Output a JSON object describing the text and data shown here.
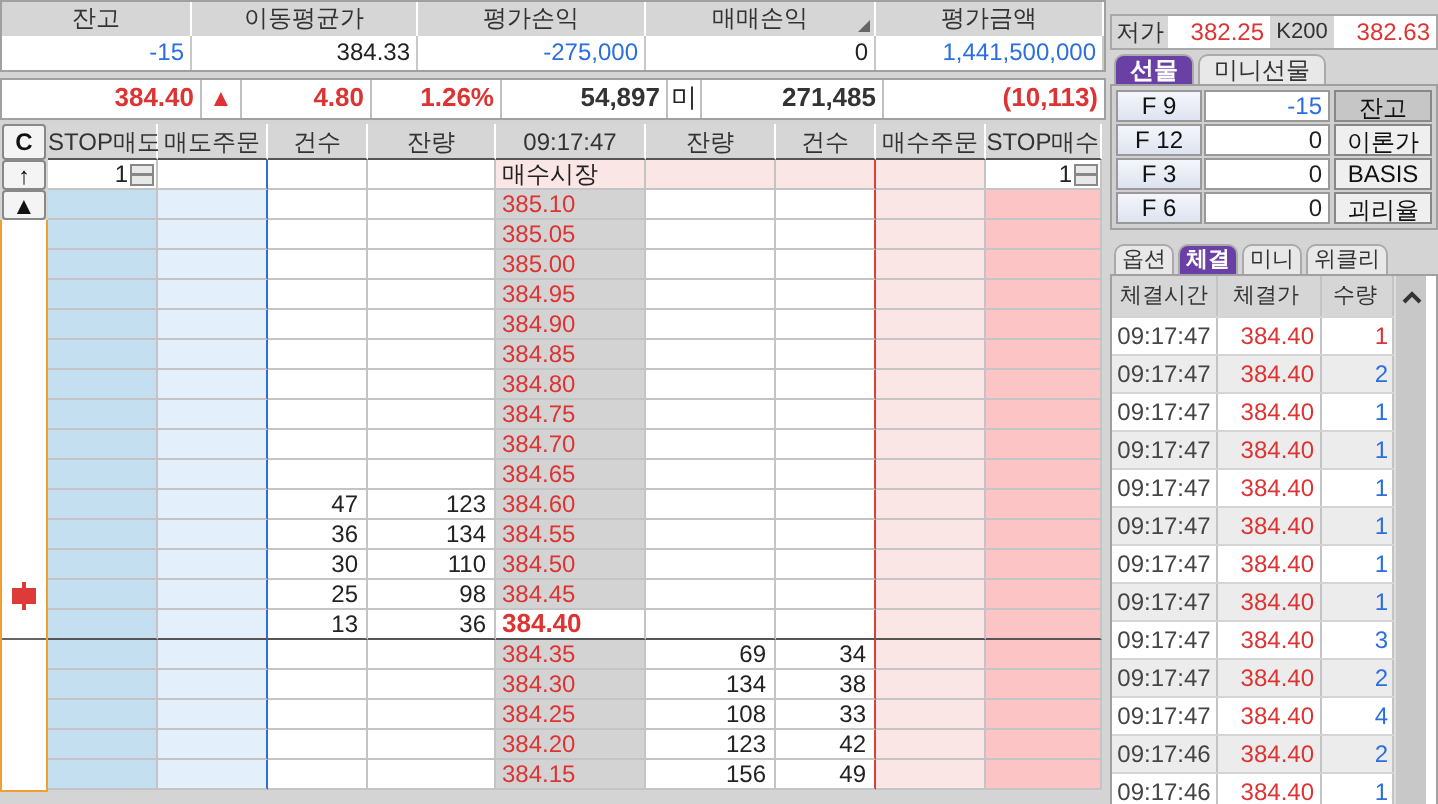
{
  "summary": {
    "columns": [
      {
        "label": "잔고",
        "value": "-15",
        "color": "#2a6ee0"
      },
      {
        "label": "이동평균가",
        "value": "384.33",
        "color": "#222222"
      },
      {
        "label": "평가손익",
        "value": "-275,000",
        "color": "#2a6ee0"
      },
      {
        "label": "매매손익",
        "value": "0",
        "color": "#222222",
        "sort_mark": true
      },
      {
        "label": "평가금액",
        "value": "1,441,500,000",
        "color": "#2a6ee0"
      }
    ]
  },
  "quote": {
    "cells": [
      {
        "text": "384.40",
        "color": "#dd3333"
      },
      {
        "text": "▲",
        "color": "#dd3333"
      },
      {
        "text": "4.80",
        "color": "#dd3333"
      },
      {
        "text": "1.26%",
        "color": "#dd3333"
      },
      {
        "text": "54,897",
        "color": "#333333"
      },
      {
        "text": "미",
        "color": "#222222"
      },
      {
        "text": "271,485",
        "color": "#333333"
      },
      {
        "text": "(10,113)",
        "color": "#dd3333"
      }
    ]
  },
  "side_buttons": [
    "C",
    "↑",
    "▲"
  ],
  "order_book": {
    "headers": [
      "STOP매도",
      "매도주문",
      "건수",
      "잔량",
      "09:17:47",
      "잔량",
      "건수",
      "매수주문",
      "STOP매수"
    ],
    "market_row": {
      "stop_sell": "1",
      "label": "매수시장",
      "stop_buy": "1"
    },
    "rows": [
      {
        "price": "385.10",
        "current": false
      },
      {
        "price": "385.05",
        "current": false
      },
      {
        "price": "385.00",
        "current": false
      },
      {
        "price": "384.95",
        "current": false
      },
      {
        "price": "384.90",
        "current": false
      },
      {
        "price": "384.85",
        "current": false
      },
      {
        "price": "384.80",
        "current": false
      },
      {
        "price": "384.75",
        "current": false
      },
      {
        "price": "384.70",
        "current": false
      },
      {
        "price": "384.65",
        "current": false
      },
      {
        "price": "384.60",
        "sell_count": "47",
        "sell_qty": "123",
        "current": false
      },
      {
        "price": "384.55",
        "sell_count": "36",
        "sell_qty": "134",
        "current": false
      },
      {
        "price": "384.50",
        "sell_count": "30",
        "sell_qty": "110",
        "current": false
      },
      {
        "price": "384.45",
        "sell_count": "25",
        "sell_qty": "98",
        "current": false,
        "marker": true
      },
      {
        "price": "384.40",
        "sell_count": "13",
        "sell_qty": "36",
        "current": true
      },
      {
        "price": "384.35",
        "buy_qty": "69",
        "buy_count": "34",
        "current": false
      },
      {
        "price": "384.30",
        "buy_qty": "134",
        "buy_count": "38",
        "current": false
      },
      {
        "price": "384.25",
        "buy_qty": "108",
        "buy_count": "33",
        "current": false
      },
      {
        "price": "384.20",
        "buy_qty": "123",
        "buy_count": "42",
        "current": false
      },
      {
        "price": "384.15",
        "buy_qty": "156",
        "buy_count": "49",
        "current": false
      }
    ]
  },
  "price_info": [
    {
      "label": "저가",
      "value": "382.25"
    },
    {
      "label": "K200",
      "value": "382.63"
    }
  ],
  "product_tabs": [
    {
      "label": "선물",
      "selected": true
    },
    {
      "label": "미니선물",
      "selected": false
    }
  ],
  "contracts": [
    {
      "label": "F 9",
      "value": "-15",
      "color": "#2a6ee0",
      "button": "잔고",
      "selected": true
    },
    {
      "label": "F 12",
      "value": "0",
      "color": "#222222",
      "button": "이론가",
      "selected": false
    },
    {
      "label": "F 3",
      "value": "0",
      "color": "#222222",
      "button": "BASIS",
      "selected": false
    },
    {
      "label": "F 6",
      "value": "0",
      "color": "#222222",
      "button": "괴리율",
      "selected": false
    }
  ],
  "view_tabs": [
    {
      "label": "옵션",
      "selected": false
    },
    {
      "label": "체결",
      "selected": true
    },
    {
      "label": "미니",
      "selected": false
    },
    {
      "label": "위클리",
      "selected": false
    }
  ],
  "trades": {
    "columns": [
      "체결시간",
      "체결가",
      "수량"
    ],
    "rows": [
      {
        "time": "09:17:47",
        "price": "384.40",
        "qty": "1",
        "color": "#dd3333"
      },
      {
        "time": "09:17:47",
        "price": "384.40",
        "qty": "2",
        "color": "#2a6ee0"
      },
      {
        "time": "09:17:47",
        "price": "384.40",
        "qty": "1",
        "color": "#2a6ee0"
      },
      {
        "time": "09:17:47",
        "price": "384.40",
        "qty": "1",
        "color": "#2a6ee0"
      },
      {
        "time": "09:17:47",
        "price": "384.40",
        "qty": "1",
        "color": "#2a6ee0"
      },
      {
        "time": "09:17:47",
        "price": "384.40",
        "qty": "1",
        "color": "#2a6ee0"
      },
      {
        "time": "09:17:47",
        "price": "384.40",
        "qty": "1",
        "color": "#2a6ee0"
      },
      {
        "time": "09:17:47",
        "price": "384.40",
        "qty": "1",
        "color": "#2a6ee0"
      },
      {
        "time": "09:17:47",
        "price": "384.40",
        "qty": "3",
        "color": "#2a6ee0"
      },
      {
        "time": "09:17:47",
        "price": "384.40",
        "qty": "2",
        "color": "#2a6ee0"
      },
      {
        "time": "09:17:47",
        "price": "384.40",
        "qty": "4",
        "color": "#2a6ee0"
      },
      {
        "time": "09:17:46",
        "price": "384.40",
        "qty": "2",
        "color": "#2a6ee0"
      },
      {
        "time": "09:17:46",
        "price": "384.40",
        "qty": "1",
        "color": "#2a6ee0"
      }
    ]
  }
}
